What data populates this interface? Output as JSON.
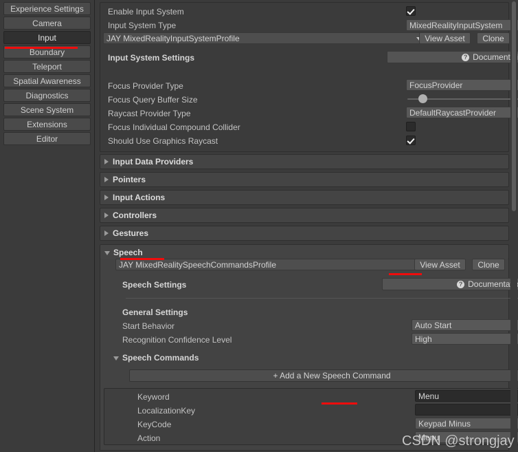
{
  "sidebar": {
    "items": [
      {
        "label": "Experience Settings",
        "selected": false
      },
      {
        "label": "Camera",
        "selected": false
      },
      {
        "label": "Input",
        "selected": true
      },
      {
        "label": "Boundary",
        "selected": false
      },
      {
        "label": "Teleport",
        "selected": false
      },
      {
        "label": "Spatial Awareness",
        "selected": false
      },
      {
        "label": "Diagnostics",
        "selected": false
      },
      {
        "label": "Scene System",
        "selected": false
      },
      {
        "label": "Extensions",
        "selected": false
      },
      {
        "label": "Editor",
        "selected": false
      }
    ]
  },
  "input_system": {
    "enable_label": "Enable Input System",
    "enable_checked": true,
    "type_label": "Input System Type",
    "type_value": "MixedRealityInputSystem",
    "profile_value": "JAY  MixedRealityInputSystemProfile",
    "view_asset_label": "View Asset",
    "clone_label": "Clone",
    "settings_header": "Input System Settings",
    "documentation_label": "Documentation",
    "doc_icon": "question-circle-icon"
  },
  "focus": {
    "provider_type_label": "Focus Provider Type",
    "provider_type_value": "FocusProvider",
    "query_buffer_label": "Focus Query Buffer Size",
    "query_buffer_value": "128",
    "raycast_type_label": "Raycast Provider Type",
    "raycast_type_value": "DefaultRaycastProvider",
    "compound_collider_label": "Focus Individual Compound Collider",
    "compound_collider_checked": false,
    "graphics_raycast_label": "Should Use Graphics Raycast",
    "graphics_raycast_checked": true
  },
  "foldouts": [
    {
      "label": "Input Data Providers",
      "open": false
    },
    {
      "label": "Pointers",
      "open": false
    },
    {
      "label": "Input Actions",
      "open": false
    },
    {
      "label": "Controllers",
      "open": false
    },
    {
      "label": "Gestures",
      "open": false
    }
  ],
  "speech": {
    "section_label": "Speech",
    "profile_value": "JAY MixedRealitySpeechCommandsProfile",
    "view_asset_label": "View Asset",
    "clone_label": "Clone",
    "settings_header": "Speech Settings",
    "documentation_label": "Documentation",
    "general_header": "General Settings",
    "start_behavior_label": "Start Behavior",
    "start_behavior_value": "Auto Start",
    "confidence_label": "Recognition Confidence Level",
    "confidence_value": "High",
    "commands_header": "Speech Commands",
    "add_command_label": "+ Add a New Speech Command",
    "command": {
      "keyword_label": "Keyword",
      "keyword_value": "Menu",
      "remove_label": "-",
      "localization_label": "LocalizationKey",
      "localization_value": "",
      "keycode_label": "KeyCode",
      "keycode_value": "Keypad Minus",
      "action_label": "Action",
      "action_value": "Menu"
    }
  },
  "annotations": {
    "highlight_color": "#f00c0c"
  },
  "watermark": {
    "text": "CSDN @strongjay"
  }
}
